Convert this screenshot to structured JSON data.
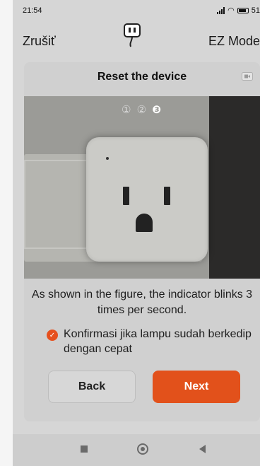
{
  "status": {
    "time": "21:54",
    "battery": "51"
  },
  "topbar": {
    "cancel_label": "Zrušiť",
    "mode_label": "EZ Mode"
  },
  "icons": {
    "device": "smart-plug-icon",
    "video": "video-icon",
    "confirm_check": "checkmark-circle-icon"
  },
  "card": {
    "title": "Reset the device",
    "steps": [
      "①",
      "②",
      "❸"
    ],
    "description": "As shown in the figure, the indicator blinks 3 times per second.",
    "confirm_text": "Konfirmasi jika lampu sudah berkedip dengan cepat",
    "back_label": "Back",
    "next_label": "Next"
  },
  "colors": {
    "accent": "#e2511b",
    "check": "#e6501e"
  }
}
